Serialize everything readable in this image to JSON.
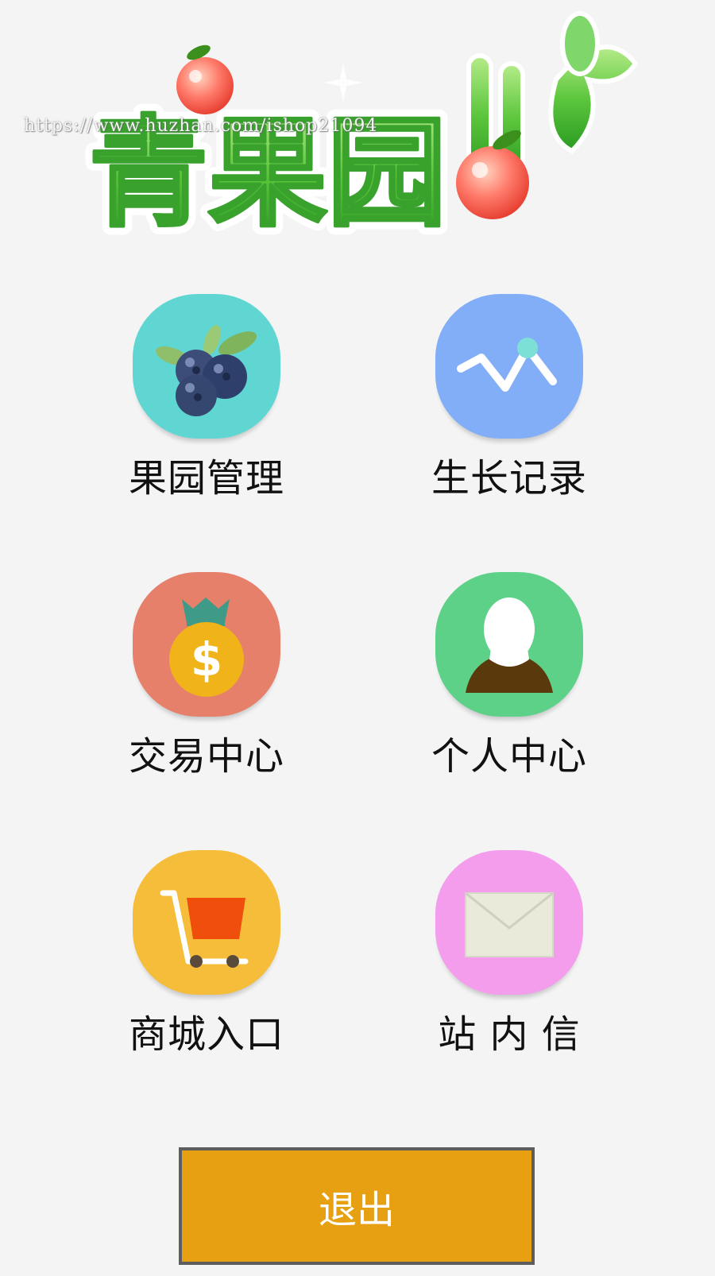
{
  "header": {
    "logo_text": "青果园",
    "watermark": "https://www.huzhan.com/ishop21094"
  },
  "menu": {
    "items": [
      {
        "label": "果园管理",
        "icon": "blueberry-icon",
        "bg": "#5fd6d2"
      },
      {
        "label": "生长记录",
        "icon": "line-chart-icon",
        "bg": "#82adf7"
      },
      {
        "label": "交易中心",
        "icon": "money-bag-icon",
        "bg": "#e6806a"
      },
      {
        "label": "个人中心",
        "icon": "person-icon",
        "bg": "#5cd187"
      },
      {
        "label": "商城入口",
        "icon": "shopping-cart-icon",
        "bg": "#f5bd3a"
      },
      {
        "label": "站 内 信",
        "icon": "mail-icon",
        "bg": "#f49ded"
      }
    ]
  },
  "footer": {
    "exit_label": "退出",
    "exit_color": "#e6a012"
  }
}
